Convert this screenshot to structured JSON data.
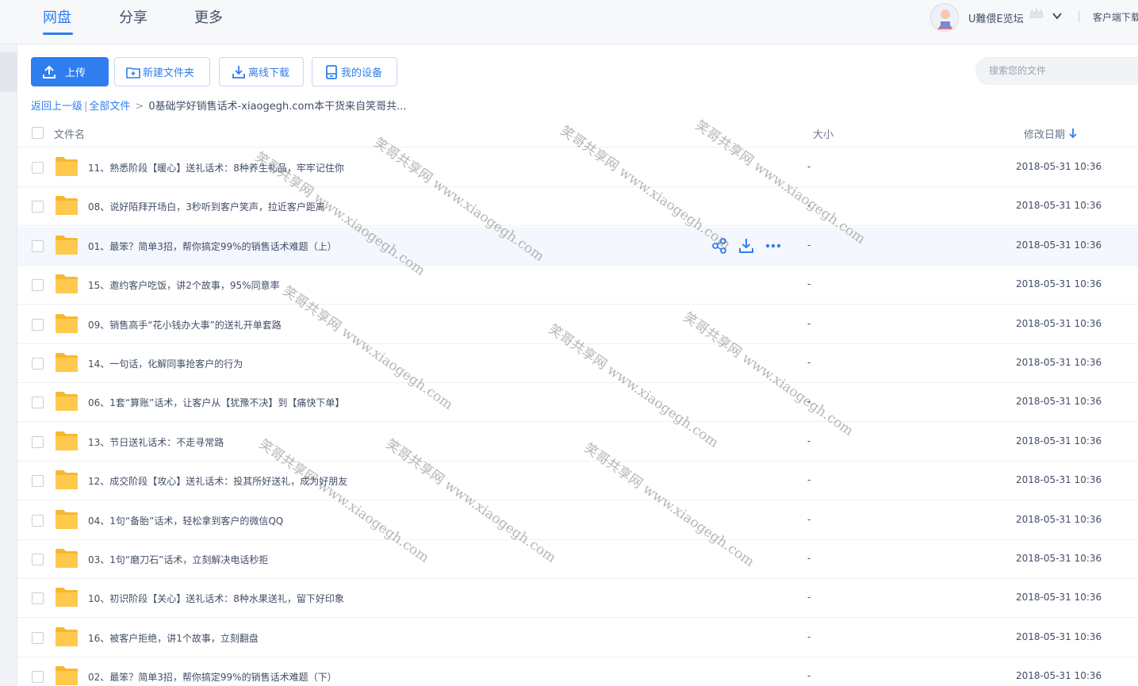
{
  "nav": {
    "tabs": [
      {
        "label": "网盘",
        "active": true
      },
      {
        "label": "分享"
      },
      {
        "label": "更多"
      }
    ],
    "username": "U難偎E览坛",
    "client_download": "客户端下载"
  },
  "toolbar": {
    "upload": "上传",
    "new_folder": "新建文件夹",
    "offline_download": "离线下载",
    "my_devices": "我的设备",
    "search_placeholder": "搜索您的文件"
  },
  "breadcrumb": {
    "back": "返回上一级",
    "sep1": "|",
    "all_files": "全部文件",
    "sep2": ">",
    "current": "0基础学好销售话术-xiaogegh.com本干货来自笑哥共..."
  },
  "table": {
    "col_name": "文件名",
    "col_size": "大小",
    "col_date": "修改日期",
    "sort_icon": "arrow-down-icon",
    "rows": [
      {
        "name": "11、熟悉阶段【暖心】送礼话术：8种养生礼品，牢牢记住你",
        "size": "-",
        "date": "2018-05-31 10:36"
      },
      {
        "name": "08、说好陌拜开场白，3秒听到客户笑声，拉近客户距离",
        "size": "-",
        "date": "2018-05-31 10:36"
      },
      {
        "name": "01、最笨？简单3招，帮你搞定99%的销售话术难题（上）",
        "size": "-",
        "date": "2018-05-31 10:36",
        "hover": true
      },
      {
        "name": "15、邀约客户吃饭，讲2个故事，95%同意率",
        "size": "-",
        "date": "2018-05-31 10:36"
      },
      {
        "name": "09、销售高手“花小钱办大事”的送礼开单套路",
        "size": "-",
        "date": "2018-05-31 10:36"
      },
      {
        "name": "14、一句话，化解同事抢客户的行为",
        "size": "-",
        "date": "2018-05-31 10:36"
      },
      {
        "name": "06、1套“算账”话术，让客户从【犹豫不决】到【痛快下单】",
        "size": "-",
        "date": "2018-05-31 10:36"
      },
      {
        "name": "13、节日送礼话术：不走寻常路",
        "size": "-",
        "date": "2018-05-31 10:36"
      },
      {
        "name": "12、成交阶段【攻心】送礼话术：投其所好送礼，成为好朋友",
        "size": "-",
        "date": "2018-05-31 10:36"
      },
      {
        "name": "04、1句“备胎”话术，轻松拿到客户的微信QQ",
        "size": "-",
        "date": "2018-05-31 10:36"
      },
      {
        "name": "03、1句“磨刀石”话术，立刻解决电话秒拒",
        "size": "-",
        "date": "2018-05-31 10:36"
      },
      {
        "name": "10、初识阶段【关心】送礼话术：8种水果送礼，留下好印象",
        "size": "-",
        "date": "2018-05-31 10:36"
      },
      {
        "name": "16、被客户拒绝，讲1个故事，立刻翻盘",
        "size": "-",
        "date": "2018-05-31 10:36"
      },
      {
        "name": "02、最笨？简单3招，帮你搞定99%的销售话术难题（下）",
        "size": "-",
        "date": "2018-05-31 10:36"
      }
    ]
  },
  "watermark_text": "笑哥共享网 www.xiaogegh.com",
  "colors": {
    "accent": "#2f7ef0",
    "folder": "#ffc94d",
    "text": "#424e67"
  }
}
